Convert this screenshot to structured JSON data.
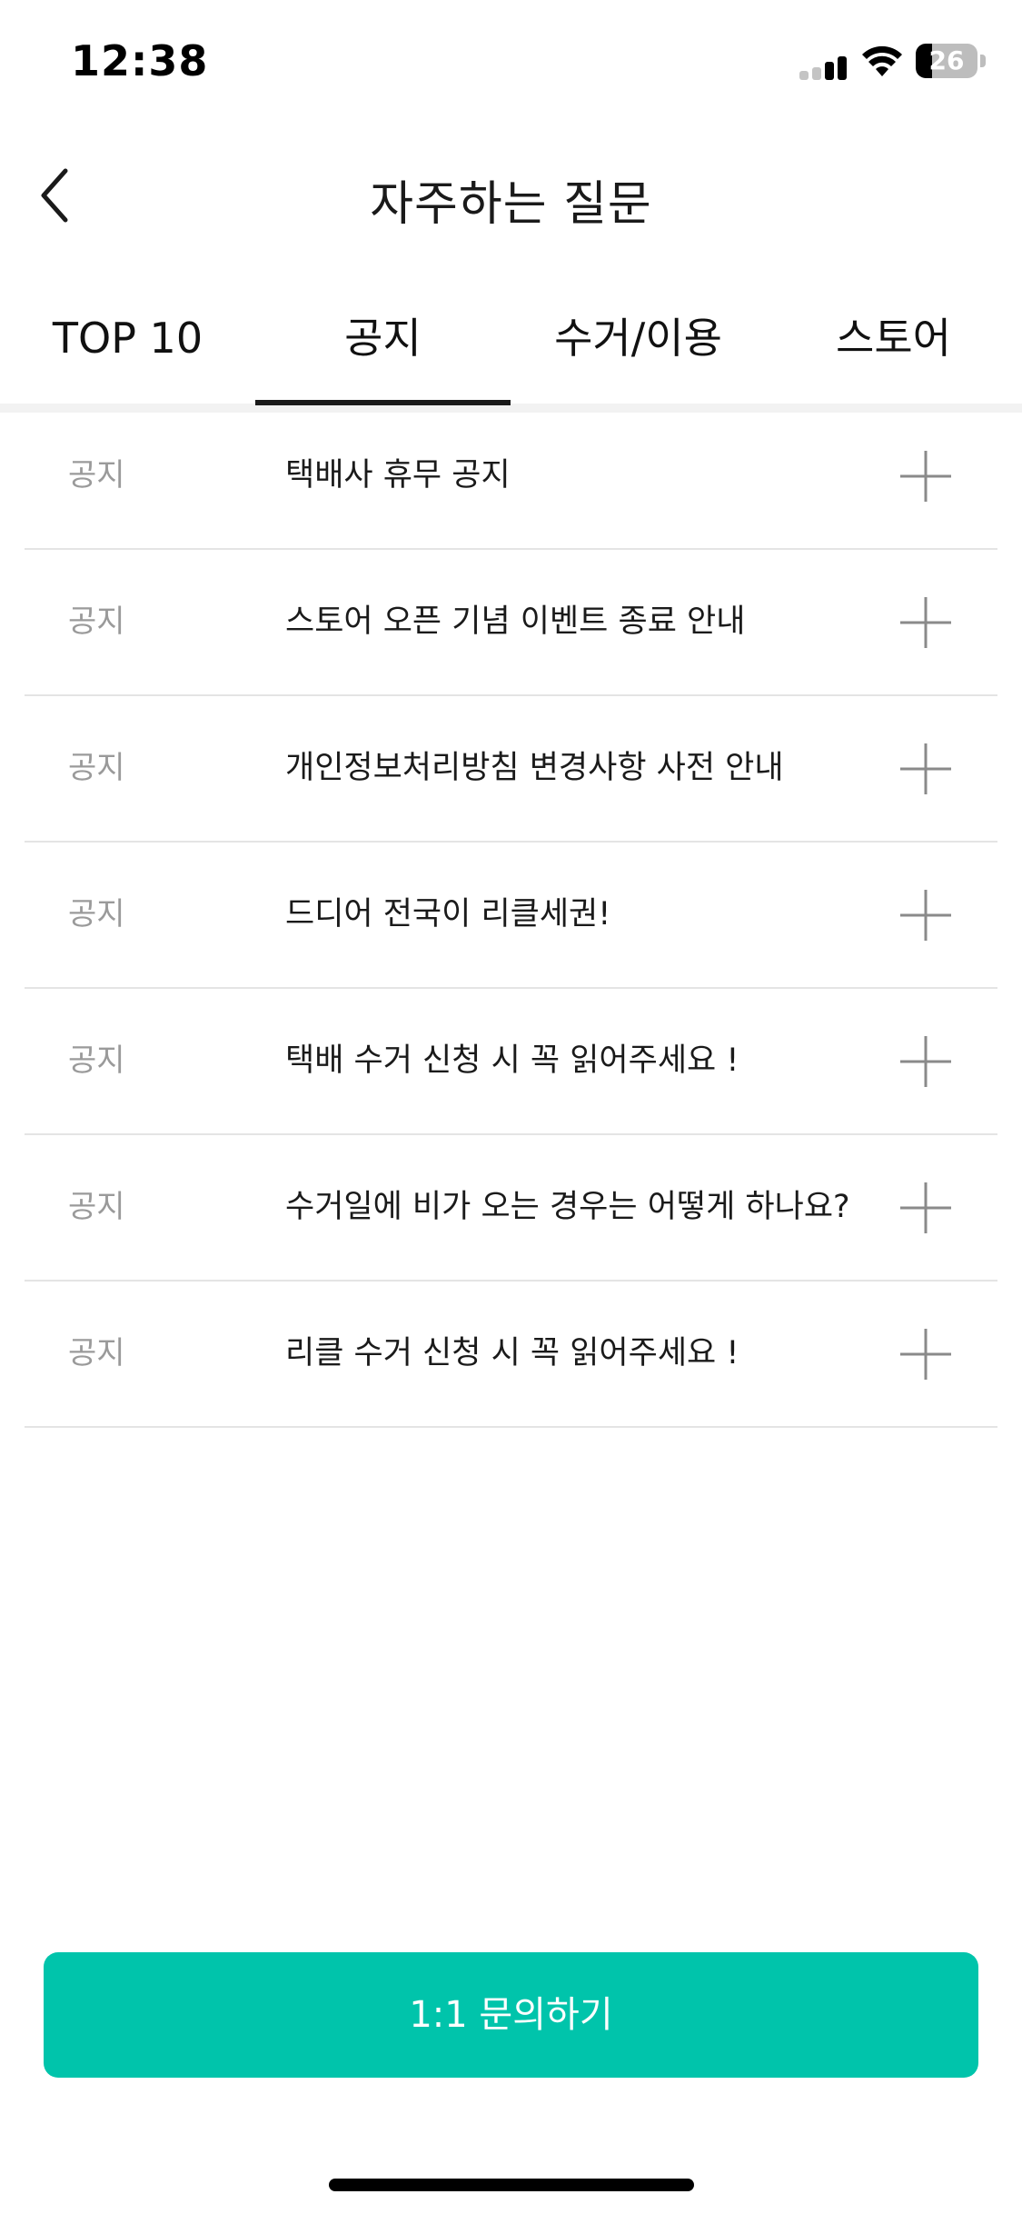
{
  "status_bar": {
    "time": "12:38",
    "battery_level": "26",
    "battery_fraction": 0.26
  },
  "header": {
    "title": "자주하는 질문",
    "back_icon": "chevron-left-icon"
  },
  "tabs": [
    {
      "label": "TOP 10",
      "active": false
    },
    {
      "label": "공지",
      "active": true
    },
    {
      "label": "수거/이용",
      "active": false
    },
    {
      "label": "스토어",
      "active": false
    }
  ],
  "notices": [
    {
      "category": "공지",
      "title": "택배사 휴무 공지"
    },
    {
      "category": "공지",
      "title": "스토어 오픈 기념 이벤트 종료 안내"
    },
    {
      "category": "공지",
      "title": "개인정보처리방침 변경사항 사전 안내"
    },
    {
      "category": "공지",
      "title": "드디어 전국이 리클세권!"
    },
    {
      "category": "공지",
      "title": "택배 수거 신청 시 꼭 읽어주세요 !"
    },
    {
      "category": "공지",
      "title": "수거일에 비가 오는 경우는 어떻게 하나요?"
    },
    {
      "category": "공지",
      "title": "리클 수거 신청 시 꼭 읽어주세요 !"
    }
  ],
  "expand_icon": "plus-icon",
  "cta": {
    "label": "1:1 문의하기"
  },
  "colors": {
    "accent": "#00c4ab",
    "text_primary": "#1a1a1a",
    "text_muted": "#9a9a9a",
    "divider": "#e4e4e4",
    "icon_gray": "#8a8a8a"
  }
}
